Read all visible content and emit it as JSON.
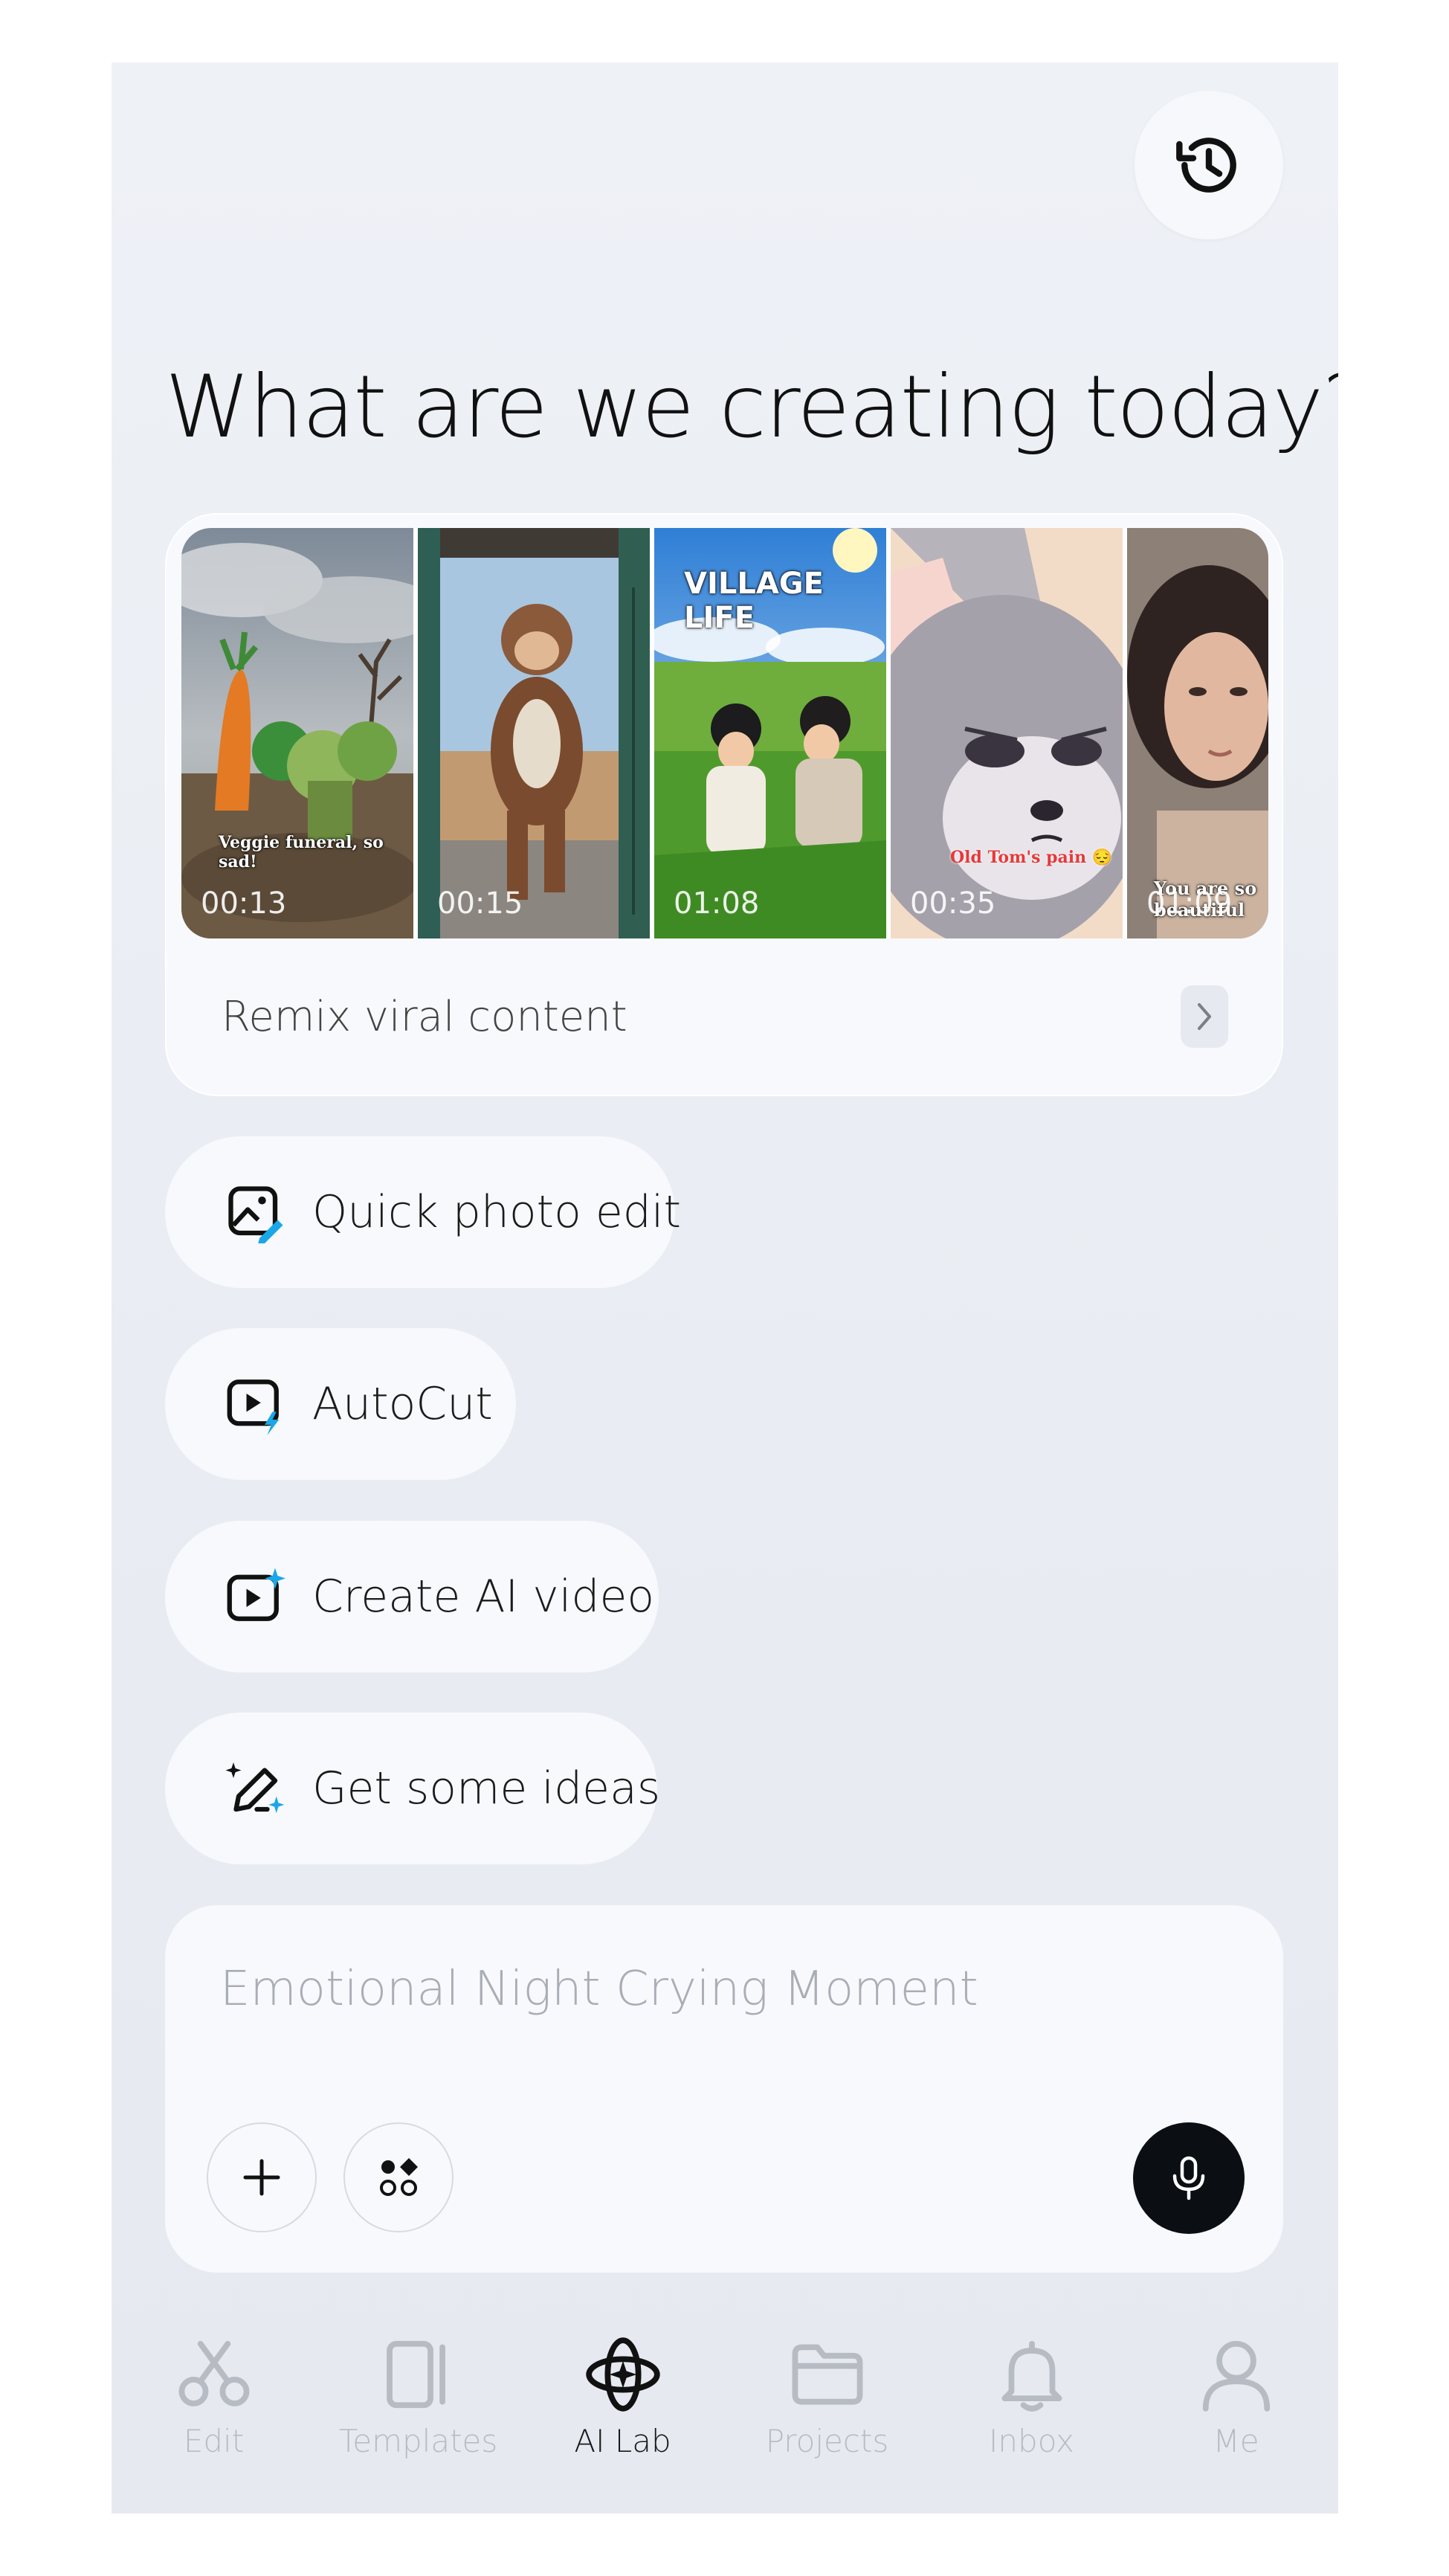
{
  "header": {
    "history_icon": "history-icon"
  },
  "headline": "What are we creating today?",
  "remix": {
    "thumbnails": [
      {
        "duration": "00:13",
        "caption": "Veggie funeral, so sad!"
      },
      {
        "duration": "00:15",
        "caption": ""
      },
      {
        "duration": "01:08",
        "caption": "VILLAGE LIFE"
      },
      {
        "duration": "00:35",
        "caption": "Old Tom's pain 😔"
      },
      {
        "duration": "01:09",
        "caption": "You are so beautiful"
      }
    ],
    "label": "Remix viral content"
  },
  "actions": [
    {
      "label": "Quick photo edit",
      "icon": "photo-edit-icon"
    },
    {
      "label": "AutoCut",
      "icon": "autocut-icon"
    },
    {
      "label": "Create AI video",
      "icon": "ai-video-icon"
    },
    {
      "label": "Get some ideas",
      "icon": "ideas-pencil-icon"
    }
  ],
  "composer": {
    "placeholder": "Emotional Night Crying Moment"
  },
  "tabs": [
    {
      "label": "Edit",
      "active": false
    },
    {
      "label": "Templates",
      "active": false
    },
    {
      "label": "AI Lab",
      "active": true
    },
    {
      "label": "Projects",
      "active": false
    },
    {
      "label": "Inbox",
      "active": false
    },
    {
      "label": "Me",
      "active": false
    }
  ],
  "colors": {
    "accent": "#1aa7e8",
    "dark": "#0b0f14",
    "muted": "#b7bcc4"
  }
}
